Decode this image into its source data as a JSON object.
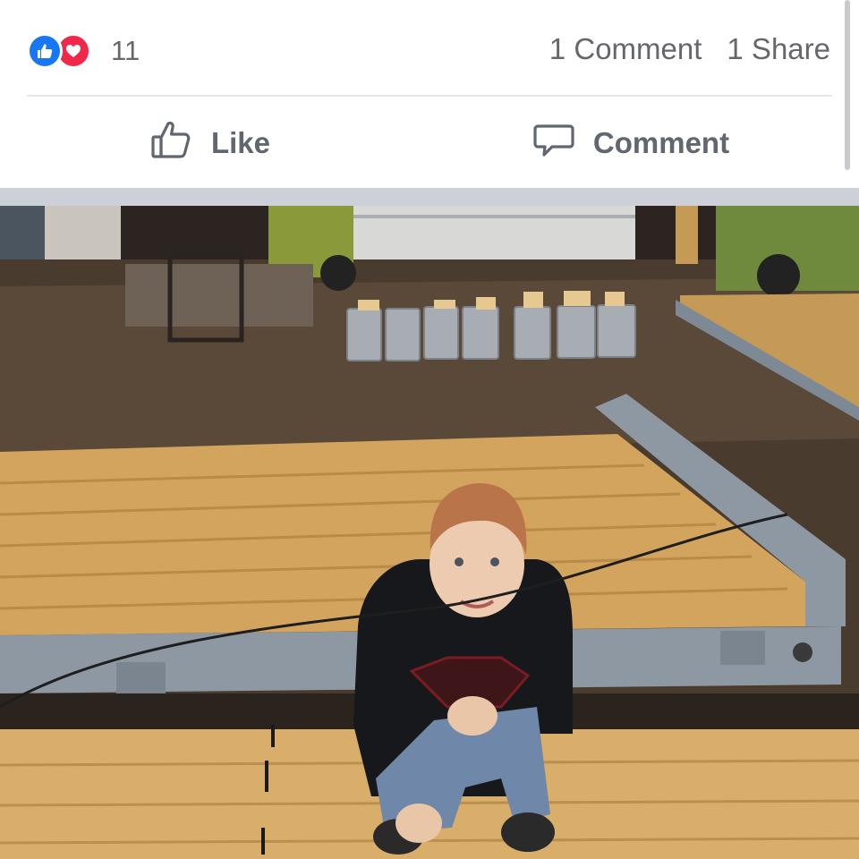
{
  "post": {
    "reaction_count": "11",
    "comments_label": "1 Comment",
    "shares_label": "1 Share",
    "reaction_icons": [
      "like-icon",
      "love-icon"
    ]
  },
  "actions": {
    "like_label": "Like",
    "comment_label": "Comment"
  },
  "colors": {
    "like_blue": "#1877f2",
    "love_red": "#f02849",
    "text_gray": "#65676b",
    "separator": "#cdd0d6"
  }
}
